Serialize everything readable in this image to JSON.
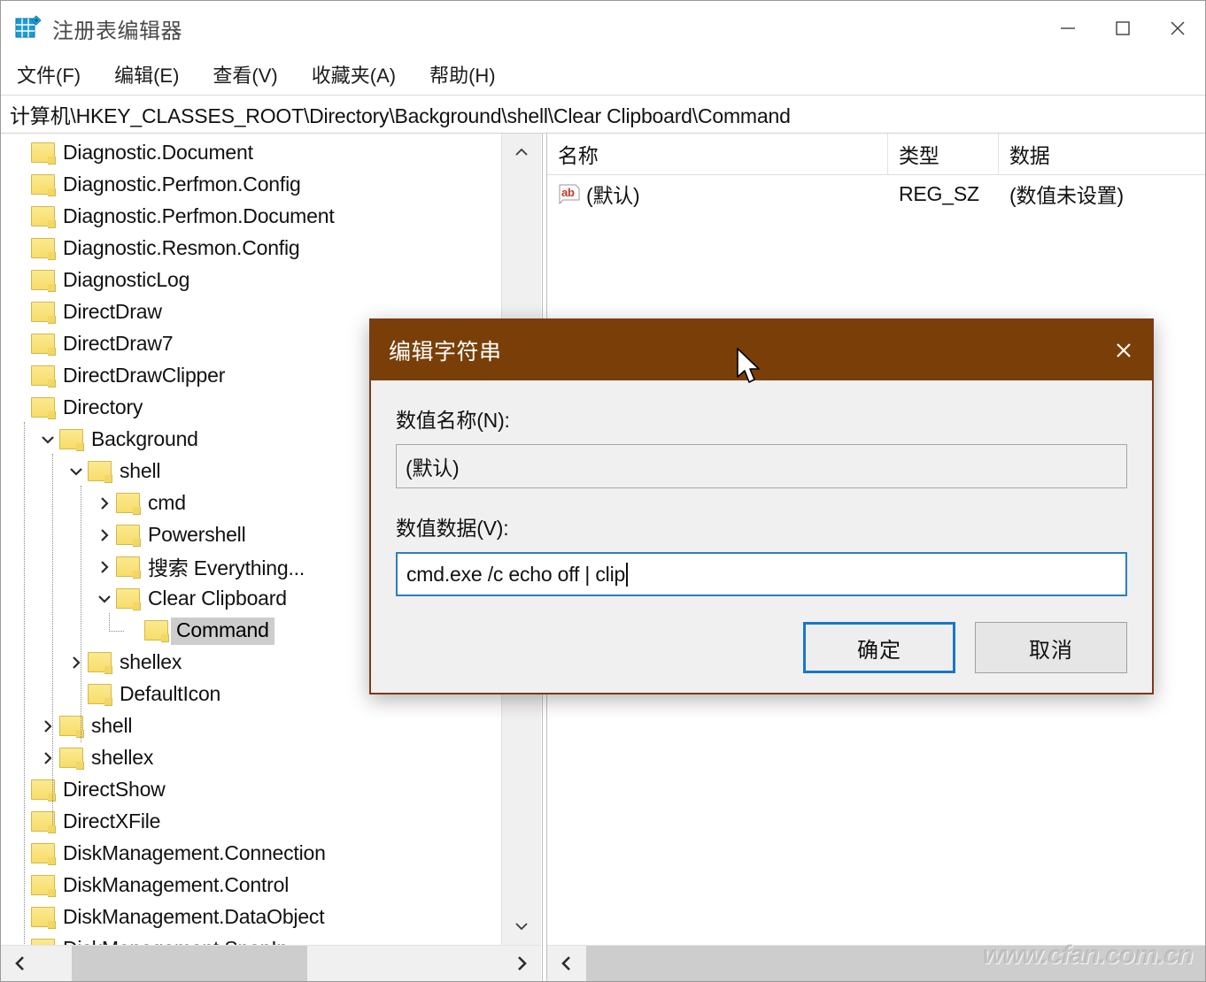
{
  "window": {
    "title": "注册表编辑器",
    "icon": "registry-editor-icon",
    "minimize_label": "─",
    "maximize_label": "□",
    "close_label": "✕"
  },
  "menubar": {
    "items": [
      {
        "label": "文件(F)",
        "name": "menu-file"
      },
      {
        "label": "编辑(E)",
        "name": "menu-edit"
      },
      {
        "label": "查看(V)",
        "name": "menu-view"
      },
      {
        "label": "收藏夹(A)",
        "name": "menu-favorites"
      },
      {
        "label": "帮助(H)",
        "name": "menu-help"
      }
    ]
  },
  "address": {
    "path": "计算机\\HKEY_CLASSES_ROOT\\Directory\\Background\\shell\\Clear Clipboard\\Command"
  },
  "tree": {
    "nodes": [
      {
        "label": "Diagnostic.Document",
        "depth": 0,
        "twisty": "none",
        "selected": false
      },
      {
        "label": "Diagnostic.Perfmon.Config",
        "depth": 0,
        "twisty": "none",
        "selected": false
      },
      {
        "label": "Diagnostic.Perfmon.Document",
        "depth": 0,
        "twisty": "none",
        "selected": false
      },
      {
        "label": "Diagnostic.Resmon.Config",
        "depth": 0,
        "twisty": "none",
        "selected": false
      },
      {
        "label": "DiagnosticLog",
        "depth": 0,
        "twisty": "none",
        "selected": false
      },
      {
        "label": "DirectDraw",
        "depth": 0,
        "twisty": "none",
        "selected": false
      },
      {
        "label": "DirectDraw7",
        "depth": 0,
        "twisty": "none",
        "selected": false
      },
      {
        "label": "DirectDrawClipper",
        "depth": 0,
        "twisty": "none",
        "selected": false
      },
      {
        "label": "Directory",
        "depth": 0,
        "twisty": "none",
        "selected": false
      },
      {
        "label": "Background",
        "depth": 1,
        "twisty": "expanded",
        "selected": false
      },
      {
        "label": "shell",
        "depth": 2,
        "twisty": "expanded",
        "selected": false
      },
      {
        "label": "cmd",
        "depth": 3,
        "twisty": "collapsed",
        "selected": false
      },
      {
        "label": "Powershell",
        "depth": 3,
        "twisty": "collapsed",
        "selected": false
      },
      {
        "label": "搜索 Everything...",
        "depth": 3,
        "twisty": "collapsed",
        "selected": false
      },
      {
        "label": "Clear Clipboard",
        "depth": 3,
        "twisty": "expanded",
        "selected": false
      },
      {
        "label": "Command",
        "depth": 4,
        "twisty": "none",
        "selected": true
      },
      {
        "label": "shellex",
        "depth": 2,
        "twisty": "collapsed",
        "selected": false
      },
      {
        "label": "DefaultIcon",
        "depth": 2,
        "twisty": "none",
        "selected": false
      },
      {
        "label": "shell",
        "depth": 1,
        "twisty": "collapsed",
        "selected": false
      },
      {
        "label": "shellex",
        "depth": 1,
        "twisty": "collapsed",
        "selected": false
      },
      {
        "label": "DirectShow",
        "depth": 0,
        "twisty": "none",
        "selected": false
      },
      {
        "label": "DirectXFile",
        "depth": 0,
        "twisty": "none",
        "selected": false
      },
      {
        "label": "DiskManagement.Connection",
        "depth": 0,
        "twisty": "none",
        "selected": false
      },
      {
        "label": "DiskManagement.Control",
        "depth": 0,
        "twisty": "none",
        "selected": false
      },
      {
        "label": "DiskManagement.DataObject",
        "depth": 0,
        "twisty": "none",
        "selected": false
      },
      {
        "label": "DiskManagement.SnapIn",
        "depth": 0,
        "twisty": "none",
        "selected": false
      }
    ]
  },
  "value_list": {
    "columns": [
      "名称",
      "类型",
      "数据"
    ],
    "rows": [
      {
        "name": "(默认)",
        "type": "REG_SZ",
        "data": "(数值未设置)",
        "icon": "string-value-icon"
      }
    ]
  },
  "dialog": {
    "title": "编辑字符串",
    "close_label": "✕",
    "value_name_label": "数值名称(N):",
    "value_name": "(默认)",
    "value_data_label": "数值数据(V):",
    "value_data": "cmd.exe /c echo off | clip",
    "ok_label": "确定",
    "cancel_label": "取消"
  },
  "scrollbars": {
    "left_up": "⌃",
    "left_down": "⌄",
    "left_prev": "‹",
    "left_next": "›",
    "right_prev": "‹"
  },
  "watermark": {
    "text": "www.cfan.com.cn"
  },
  "colors": {
    "dialog_titlebar": "#7a3f08",
    "dialog_border": "#7b3b17",
    "focus_blue": "#1878c8",
    "input_focus_border": "#2a7fbd",
    "selection_gray": "#cdcdcd",
    "folder_yellow": "#f7dd6a"
  }
}
